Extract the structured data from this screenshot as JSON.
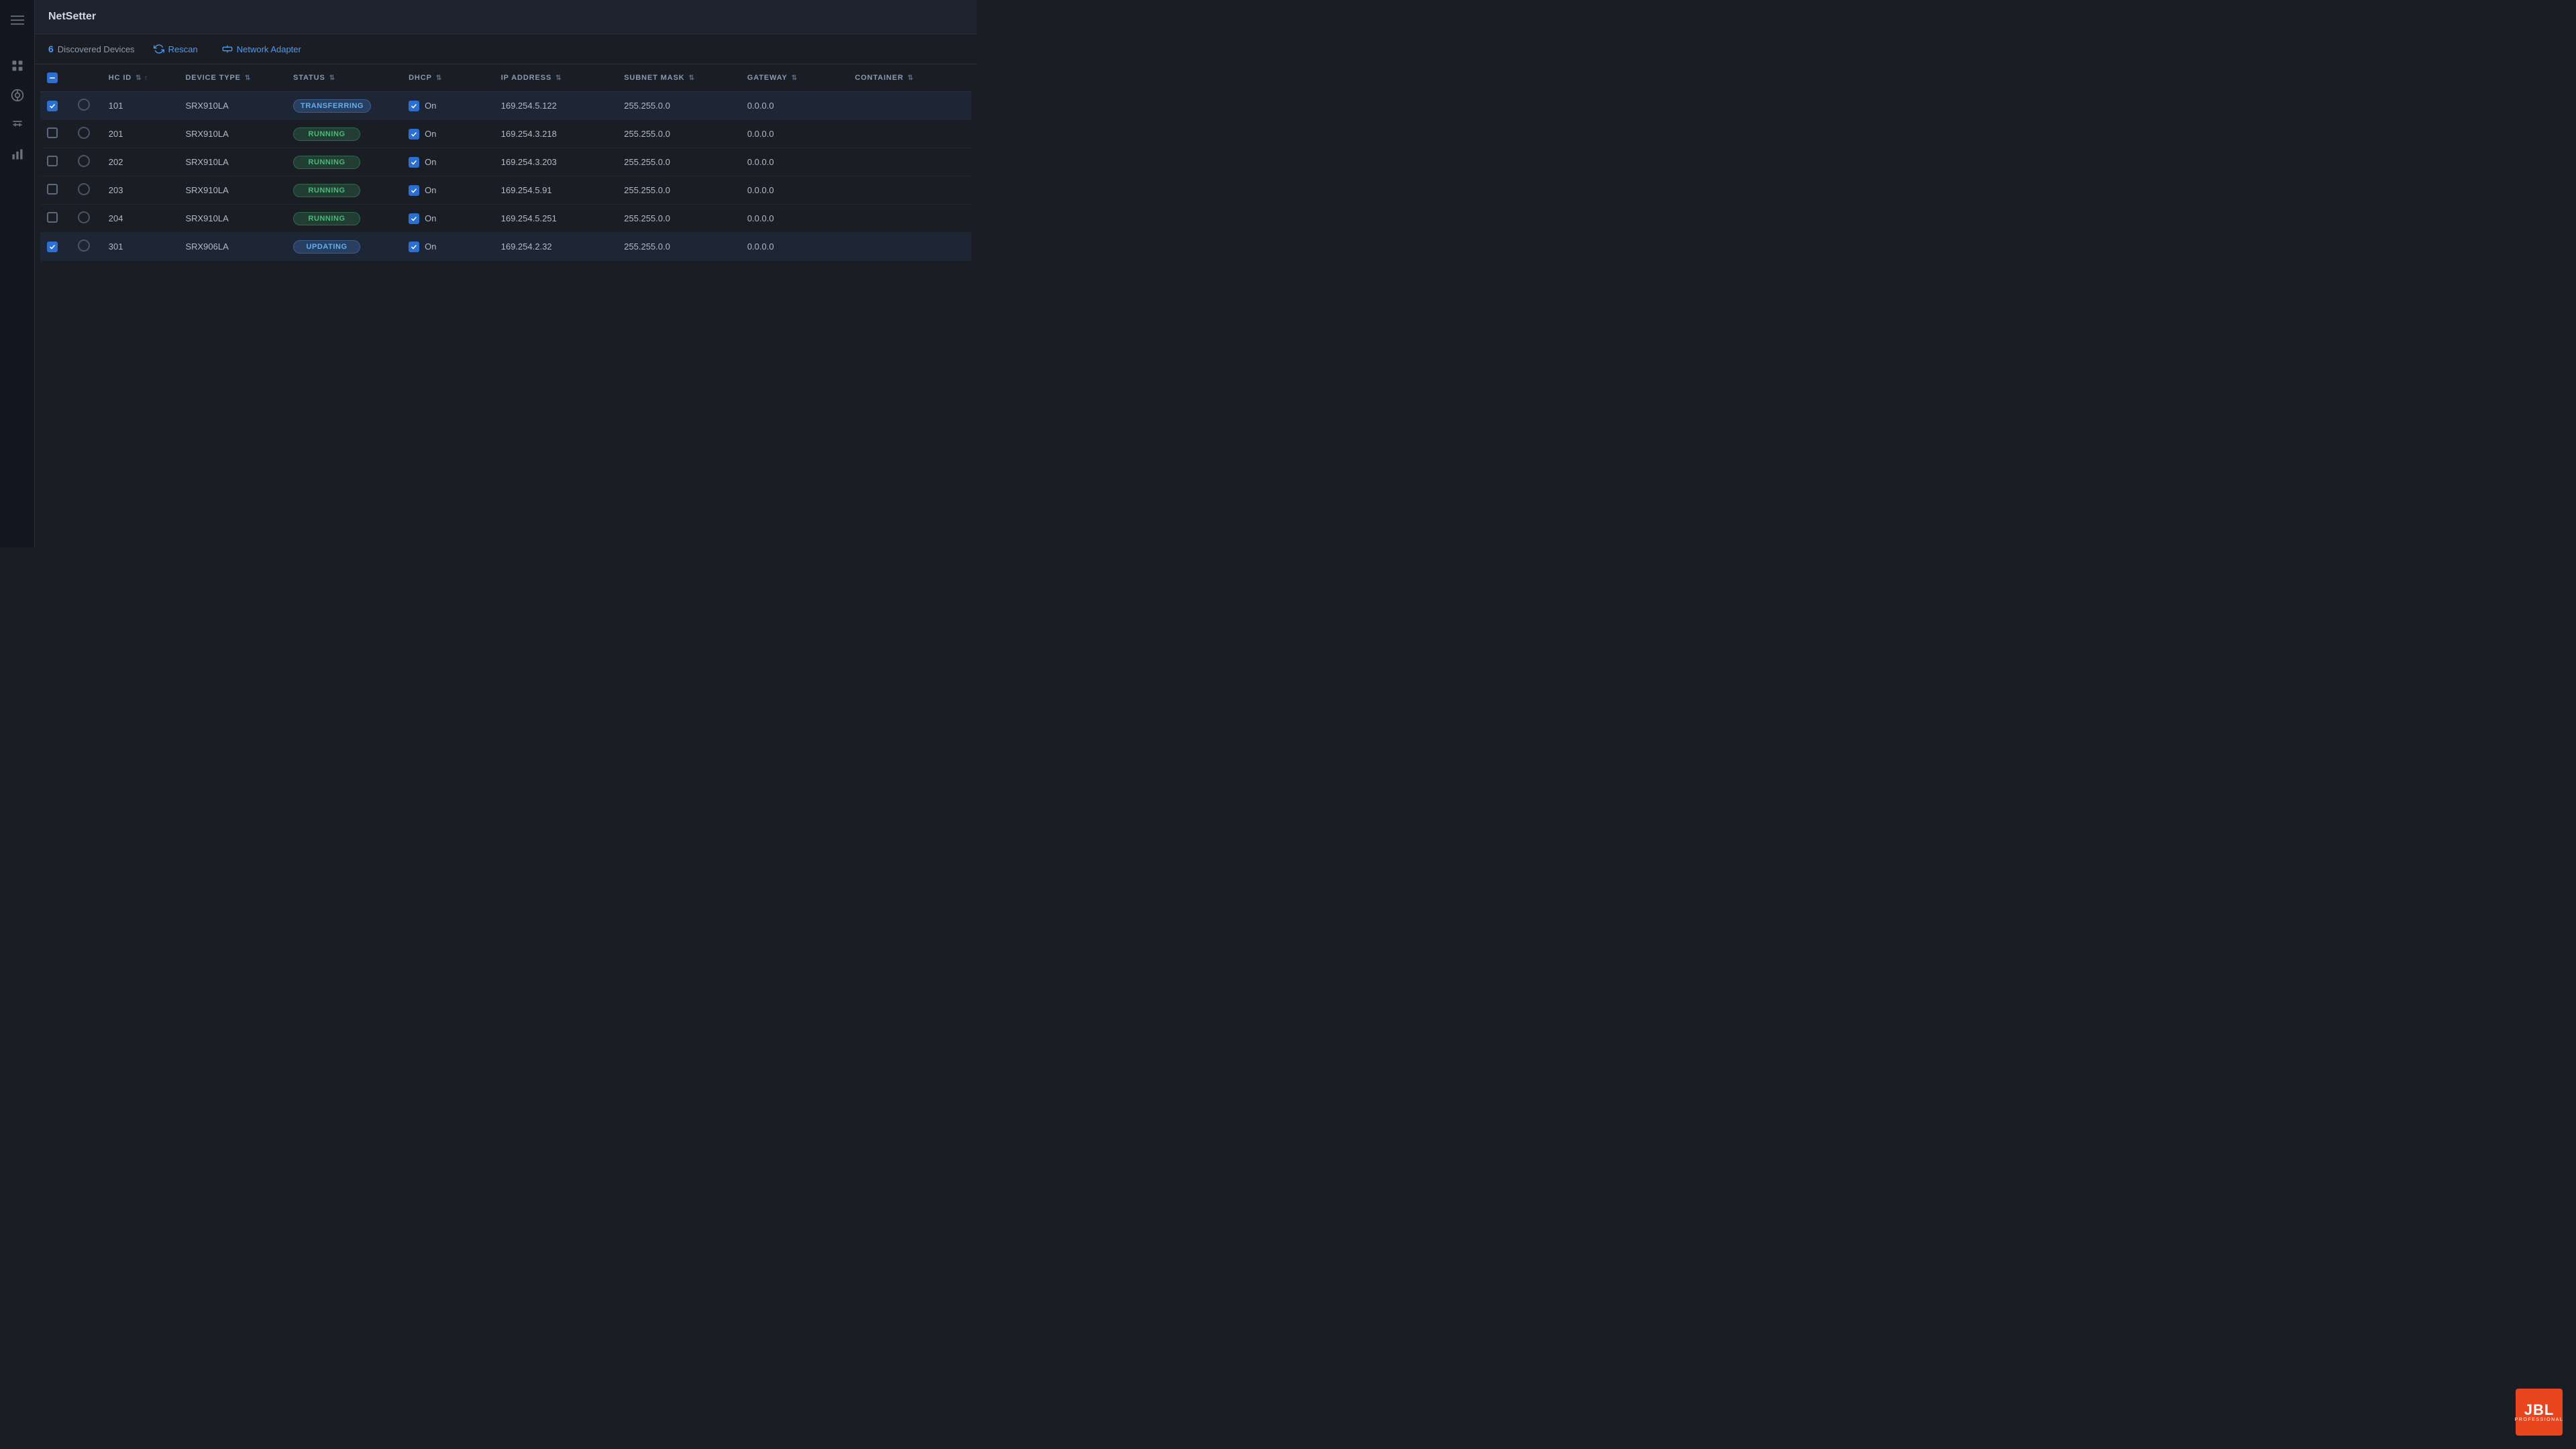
{
  "app": {
    "title": "NetSetter"
  },
  "toolbar": {
    "discovered_count": "6",
    "discovered_label": "Discovered Devices",
    "rescan_label": "Rescan",
    "network_adapter_label": "Network Adapter"
  },
  "table": {
    "columns": [
      {
        "id": "cb",
        "label": ""
      },
      {
        "id": "circle",
        "label": ""
      },
      {
        "id": "hcid",
        "label": "HC ID"
      },
      {
        "id": "device_type",
        "label": "DEVICE TYPE"
      },
      {
        "id": "status",
        "label": "STATUS"
      },
      {
        "id": "dhcp",
        "label": "DHCP"
      },
      {
        "id": "ip_address",
        "label": "IP ADDRESS"
      },
      {
        "id": "subnet_mask",
        "label": "SUBNET MASK"
      },
      {
        "id": "gateway",
        "label": "GATEWAY"
      },
      {
        "id": "container",
        "label": "CONTAINER"
      }
    ],
    "rows": [
      {
        "id": "row-101",
        "selected": true,
        "hcid": "101",
        "device_type": "SRX910LA",
        "status": "TRANSFERRING",
        "status_class": "status-transferring",
        "dhcp_checked": true,
        "dhcp_label": "On",
        "ip_address": "169.254.5.122",
        "subnet_mask": "255.255.0.0",
        "gateway": "0.0.0.0",
        "container": ""
      },
      {
        "id": "row-201",
        "selected": false,
        "hcid": "201",
        "device_type": "SRX910LA",
        "status": "RUNNING",
        "status_class": "status-running",
        "dhcp_checked": true,
        "dhcp_label": "On",
        "ip_address": "169.254.3.218",
        "subnet_mask": "255.255.0.0",
        "gateway": "0.0.0.0",
        "container": ""
      },
      {
        "id": "row-202",
        "selected": false,
        "hcid": "202",
        "device_type": "SRX910LA",
        "status": "RUNNING",
        "status_class": "status-running",
        "dhcp_checked": true,
        "dhcp_label": "On",
        "ip_address": "169.254.3.203",
        "subnet_mask": "255.255.0.0",
        "gateway": "0.0.0.0",
        "container": ""
      },
      {
        "id": "row-203",
        "selected": false,
        "hcid": "203",
        "device_type": "SRX910LA",
        "status": "RUNNING",
        "status_class": "status-running",
        "dhcp_checked": true,
        "dhcp_label": "On",
        "ip_address": "169.254.5.91",
        "subnet_mask": "255.255.0.0",
        "gateway": "0.0.0.0",
        "container": ""
      },
      {
        "id": "row-204",
        "selected": false,
        "hcid": "204",
        "device_type": "SRX910LA",
        "status": "RUNNING",
        "status_class": "status-running",
        "dhcp_checked": true,
        "dhcp_label": "On",
        "ip_address": "169.254.5.251",
        "subnet_mask": "255.255.0.0",
        "gateway": "0.0.0.0",
        "container": ""
      },
      {
        "id": "row-301",
        "selected": true,
        "hcid": "301",
        "device_type": "SRX906LA",
        "status": "UPDATING",
        "status_class": "status-updating",
        "dhcp_checked": true,
        "dhcp_label": "On",
        "ip_address": "169.254.2.32",
        "subnet_mask": "255.255.0.0",
        "gateway": "0.0.0.0",
        "container": ""
      }
    ]
  },
  "jbl": {
    "text": "JBL",
    "subtext": "PROFESSIONAL"
  },
  "sidebar": {
    "items": [
      {
        "id": "menu",
        "icon": "menu"
      },
      {
        "id": "dashboard",
        "icon": "dashboard"
      },
      {
        "id": "network",
        "icon": "network"
      },
      {
        "id": "settings",
        "icon": "settings"
      },
      {
        "id": "analytics",
        "icon": "analytics"
      }
    ]
  }
}
